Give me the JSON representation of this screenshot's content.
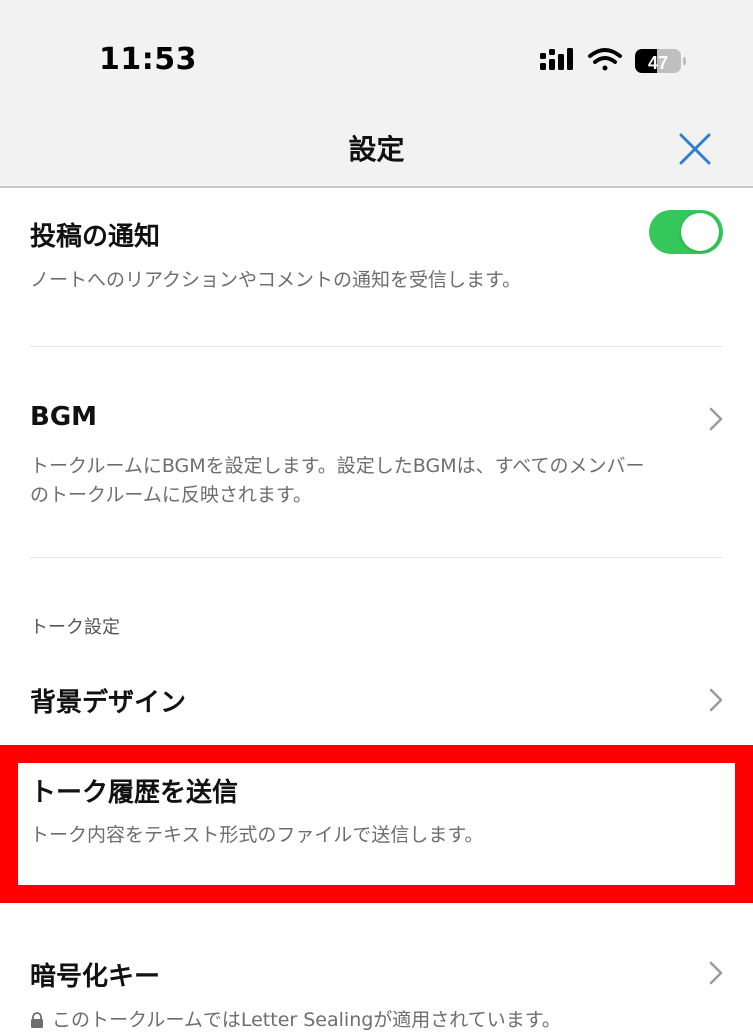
{
  "status": {
    "time": "11:53",
    "battery": "47"
  },
  "header": {
    "title": "設定"
  },
  "rows": {
    "post_notification": {
      "title": "投稿の通知",
      "description": "ノートへのリアクションやコメントの通知を受信します。",
      "toggle_on": true
    },
    "bgm": {
      "title": "BGM",
      "description_line1": "トークルームにBGMを設定します。設定したBGMは、すべてのメンバー",
      "description_line2": "のトークルームに反映されます。"
    },
    "section_talk_settings": "トーク設定",
    "background_design": {
      "title": "背景デザイン"
    },
    "send_history": {
      "title": "トーク履歴を送信",
      "description": "トーク内容をテキスト形式のファイルで送信します。"
    },
    "encryption_key": {
      "title": "暗号化キー",
      "description": "このトークルームではLetter Sealingが適用されています。"
    }
  },
  "colors": {
    "toggle_on": "#34c759",
    "highlight": "#ff0000",
    "close_icon": "#2f7fd1"
  }
}
